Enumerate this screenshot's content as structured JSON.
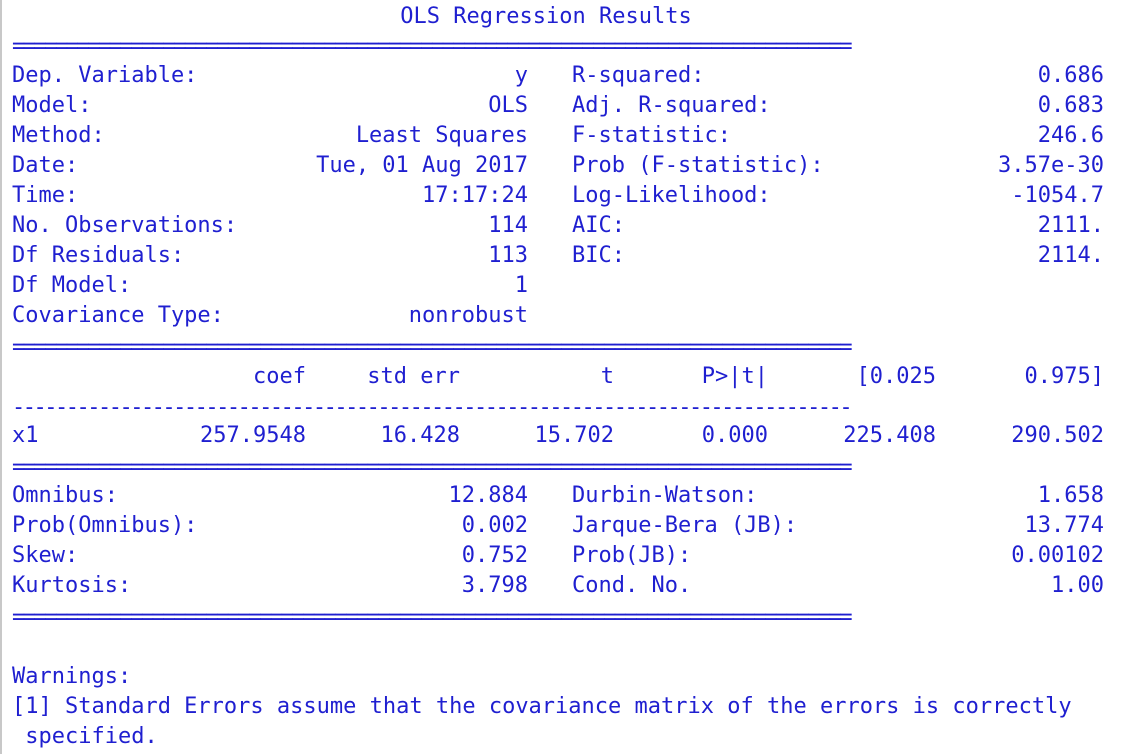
{
  "title": "OLS Regression Results",
  "separator_double": "==============================================================================",
  "separator_single": "------------------------------------------------------------------------------",
  "info_rows": [
    {
      "l_label": "Dep. Variable:",
      "l_value": "y",
      "r_label": "R-squared:",
      "r_value": "0.686"
    },
    {
      "l_label": "Model:",
      "l_value": "OLS",
      "r_label": "Adj. R-squared:",
      "r_value": "0.683"
    },
    {
      "l_label": "Method:",
      "l_value": "Least Squares",
      "r_label": "F-statistic:",
      "r_value": "246.6"
    },
    {
      "l_label": "Date:",
      "l_value": "Tue, 01 Aug 2017",
      "r_label": "Prob (F-statistic):",
      "r_value": "3.57e-30"
    },
    {
      "l_label": "Time:",
      "l_value": "17:17:24",
      "r_label": "Log-Likelihood:",
      "r_value": "-1054.7"
    },
    {
      "l_label": "No. Observations:",
      "l_value": "114",
      "r_label": "AIC:",
      "r_value": "2111."
    },
    {
      "l_label": "Df Residuals:",
      "l_value": "113",
      "r_label": "BIC:",
      "r_value": "2114."
    },
    {
      "l_label": "Df Model:",
      "l_value": "1",
      "r_label": "",
      "r_value": ""
    },
    {
      "l_label": "Covariance Type:",
      "l_value": "nonrobust",
      "r_label": "",
      "r_value": ""
    }
  ],
  "coef_table": {
    "headers": [
      "",
      "coef",
      "std err",
      "t",
      "P>|t|",
      "[0.025",
      "0.975]"
    ],
    "rows": [
      [
        "x1",
        "257.9548",
        "16.428",
        "15.702",
        "0.000",
        "225.408",
        "290.502"
      ]
    ]
  },
  "diag_rows": [
    {
      "l_label": "Omnibus:",
      "l_value": "12.884",
      "r_label": "Durbin-Watson:",
      "r_value": "1.658"
    },
    {
      "l_label": "Prob(Omnibus):",
      "l_value": "0.002",
      "r_label": "Jarque-Bera (JB):",
      "r_value": "13.774"
    },
    {
      "l_label": "Skew:",
      "l_value": "0.752",
      "r_label": "Prob(JB):",
      "r_value": "0.00102"
    },
    {
      "l_label": "Kurtosis:",
      "l_value": "3.798",
      "r_label": "Cond. No.",
      "r_value": "1.00"
    }
  ],
  "warnings": {
    "heading": "Warnings:",
    "line1": "[1] Standard Errors assume that the covariance matrix of the errors is correctly",
    "line2": " specified."
  },
  "colors": {
    "text": "#1f1fd0",
    "background": "#ffffff"
  }
}
